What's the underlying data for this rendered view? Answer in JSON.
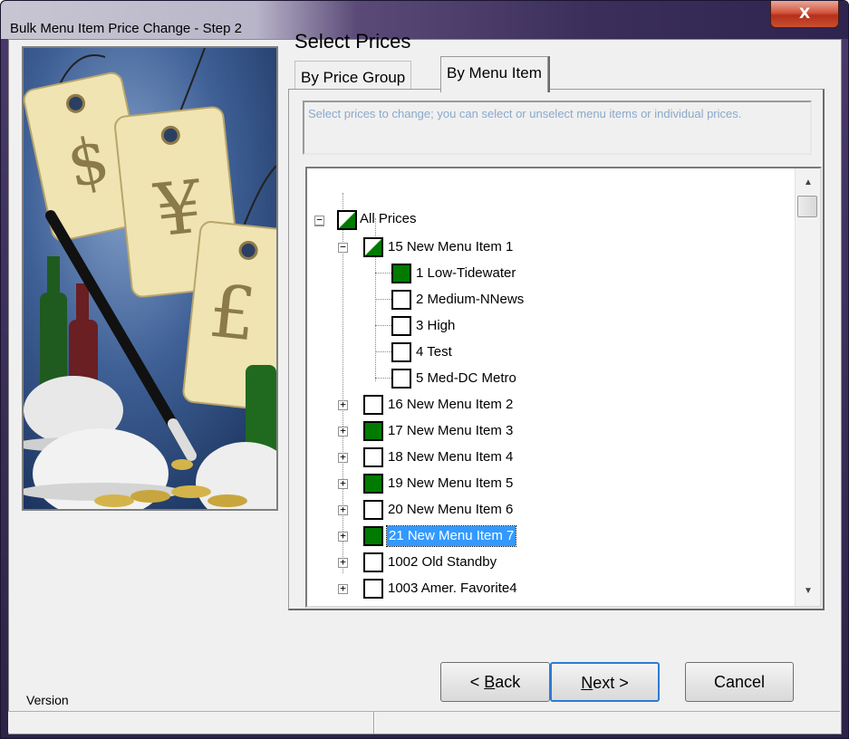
{
  "window": {
    "title": "Bulk Menu Item Price Change  -  Step 2",
    "close_glyph": "X"
  },
  "heading": "Select Prices",
  "tabs": [
    {
      "label": "By Price Group",
      "active": false
    },
    {
      "label": "By Menu Item",
      "active": true
    }
  ],
  "instructions": "Select prices to change; you can select or unselect menu items or individual prices.",
  "tree": {
    "root": {
      "label": "All Prices",
      "state": "partial",
      "expanded": true
    },
    "items": [
      {
        "label": "15 New Menu Item 1",
        "state": "partial",
        "expanded": true
      },
      {
        "label": "1 Low-Tidewater",
        "state": "checked",
        "child": true
      },
      {
        "label": "2 Medium-NNews",
        "state": "unchecked",
        "child": true
      },
      {
        "label": "3 High",
        "state": "unchecked",
        "child": true
      },
      {
        "label": "4 Test",
        "state": "unchecked",
        "child": true
      },
      {
        "label": "5 Med-DC Metro",
        "state": "unchecked",
        "child": true
      },
      {
        "label": "16 New Menu Item 2",
        "state": "unchecked",
        "expanded": false
      },
      {
        "label": "17 New Menu Item 3",
        "state": "checked",
        "expanded": false
      },
      {
        "label": "18 New Menu Item 4",
        "state": "unchecked",
        "expanded": false
      },
      {
        "label": "19 New Menu Item 5",
        "state": "checked",
        "expanded": false
      },
      {
        "label": "20 New Menu Item 6",
        "state": "unchecked",
        "expanded": false
      },
      {
        "label": "21 New Menu Item 7",
        "state": "checked",
        "expanded": false,
        "selected": true
      },
      {
        "label": "1002 Old Standby",
        "state": "unchecked",
        "expanded": false
      },
      {
        "label": "1003 Amer. Favorite4",
        "state": "unchecked",
        "expanded": false
      }
    ]
  },
  "buttons": {
    "back_prefix": "< ",
    "back_hotkey": "B",
    "back_rest": "ack",
    "next_hotkey": "N",
    "next_rest": "ext >",
    "cancel": "Cancel"
  },
  "version_label": "Version",
  "colors": {
    "checked_green": "#007a00",
    "selection_blue": "#3399ff",
    "instruction_text": "#8aa9c9"
  }
}
